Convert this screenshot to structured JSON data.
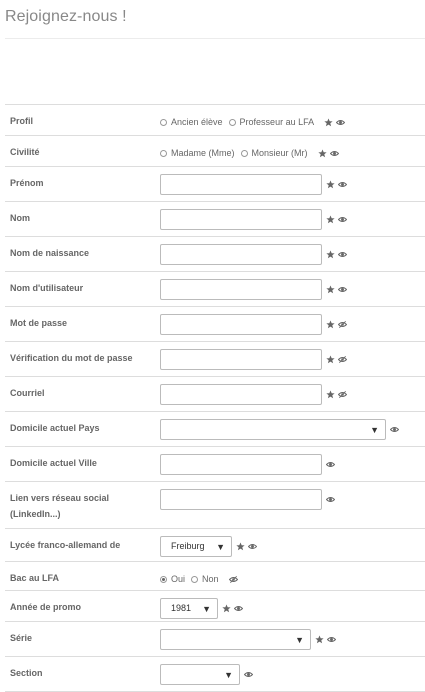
{
  "page": {
    "title": "Rejoignez-nous !"
  },
  "rows": [
    {
      "label": "Profil",
      "type": "radio",
      "options": [
        "Ancien élève",
        "Professeur au LFA"
      ],
      "checked": -1,
      "star": true,
      "eye": "open"
    },
    {
      "label": "Civilité",
      "type": "radio",
      "options": [
        "Madame (Mme)",
        "Monsieur (Mr)"
      ],
      "checked": -1,
      "star": true,
      "eye": "open"
    },
    {
      "label": "Prénom",
      "type": "text",
      "star": true,
      "eye": "open"
    },
    {
      "label": "Nom",
      "type": "text",
      "star": true,
      "eye": "open"
    },
    {
      "label": "Nom de naissance",
      "type": "text",
      "star": true,
      "eye": "open"
    },
    {
      "label": "Nom d'utilisateur",
      "type": "text",
      "star": true,
      "eye": "open"
    },
    {
      "label": "Mot de passe",
      "type": "text",
      "star": true,
      "eye": "closed"
    },
    {
      "label": "Vérification du mot de passe",
      "type": "text",
      "star": true,
      "eye": "closed"
    },
    {
      "label": "Courriel",
      "type": "text",
      "star": true,
      "eye": "closed"
    },
    {
      "label": "Domicile actuel Pays",
      "type": "select",
      "value": "",
      "star": false,
      "eye": "open"
    },
    {
      "label": "Domicile actuel Ville",
      "type": "text",
      "star": false,
      "eye": "open"
    },
    {
      "label": "Lien vers réseau social (LinkedIn...)",
      "type": "text",
      "star": false,
      "eye": "open"
    },
    {
      "label": "Lycée franco-allemand de",
      "type": "select",
      "value": "Freiburg",
      "star": true,
      "eye": "open"
    },
    {
      "label": "Bac au LFA",
      "type": "radio",
      "options": [
        "Oui",
        "Non"
      ],
      "checked": 0,
      "star": false,
      "eye": "closed"
    },
    {
      "label": "Année de promo",
      "type": "select",
      "value": "1981",
      "star": true,
      "eye": "open"
    },
    {
      "label": "Série",
      "type": "select",
      "value": "",
      "star": true,
      "eye": "open"
    },
    {
      "label": "Section",
      "type": "select",
      "value": "",
      "star": false,
      "eye": "open"
    }
  ]
}
